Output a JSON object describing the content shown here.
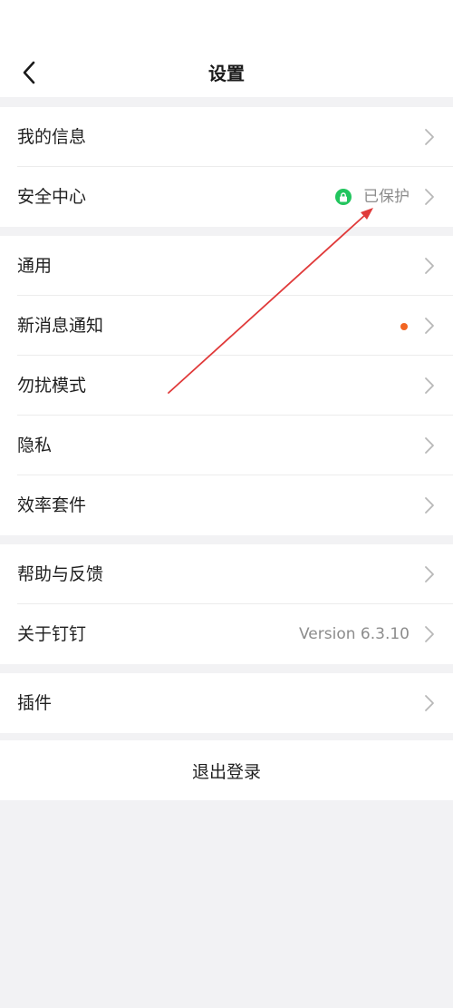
{
  "header": {
    "title": "设置",
    "back_icon": "chevron-left-icon"
  },
  "groups": [
    {
      "items": [
        {
          "label": "我的信息"
        },
        {
          "label": "安全中心",
          "status": "已保护",
          "status_icon": "lock-icon",
          "status_color": "#22c55e"
        }
      ]
    },
    {
      "items": [
        {
          "label": "通用"
        },
        {
          "label": "新消息通知",
          "badge": "dot",
          "badge_color": "#f26522"
        },
        {
          "label": "勿扰模式"
        },
        {
          "label": "隐私"
        },
        {
          "label": "效率套件"
        }
      ]
    },
    {
      "items": [
        {
          "label": "帮助与反馈"
        },
        {
          "label": "关于钉钉",
          "value": "Version 6.3.10"
        }
      ]
    },
    {
      "items": [
        {
          "label": "插件"
        }
      ]
    }
  ],
  "logout": {
    "label": "退出登录"
  },
  "colors": {
    "background": "#f2f2f4",
    "card": "#ffffff",
    "accent_green": "#22c55e",
    "notify_dot": "#f26522",
    "annotation_arrow": "#e03a3a"
  }
}
